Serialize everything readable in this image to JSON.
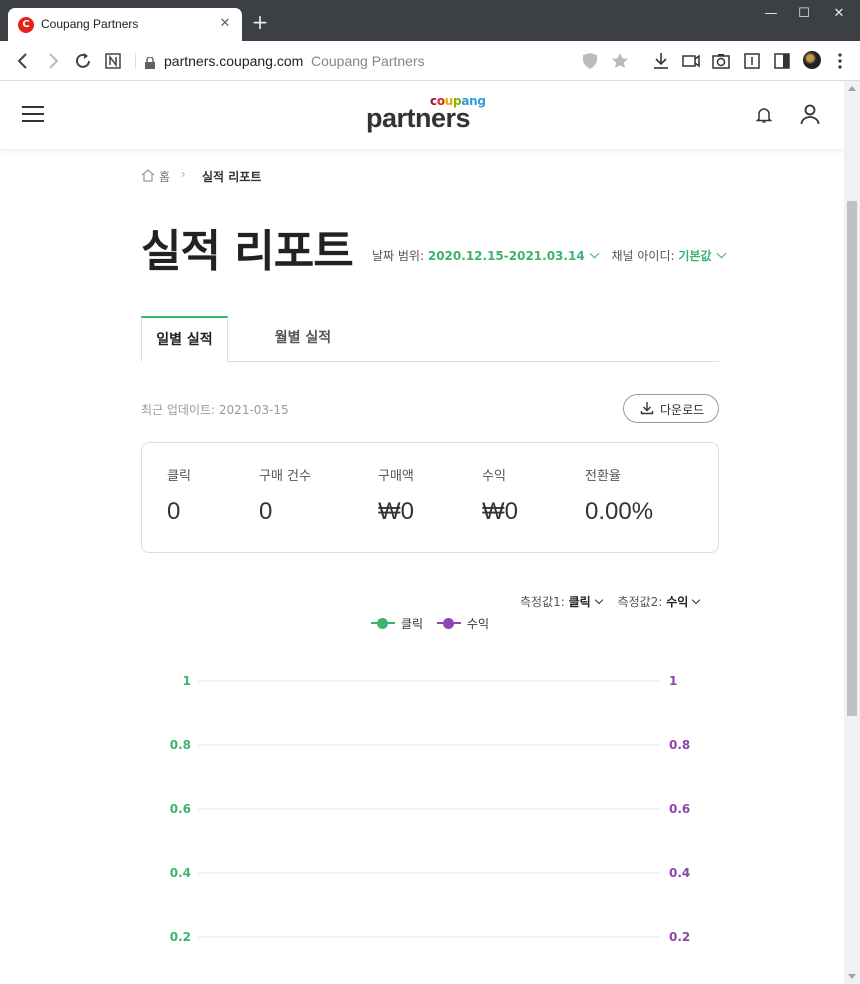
{
  "browser": {
    "tab_title": "Coupang Partners",
    "url": "partners.coupang.com",
    "page_title": "Coupang Partners"
  },
  "header": {
    "logo_small": "coupang",
    "logo_main": "partners"
  },
  "breadcrumb": {
    "home": "홈",
    "current": "실적 리포트"
  },
  "page": {
    "title": "실적 리포트",
    "date_range_label": "날짜 범위:",
    "date_range_value": "2020.12.15-2021.03.14",
    "channel_label": "채널 아이디:",
    "channel_value": "기본값"
  },
  "tabs": [
    {
      "label": "일별 실적",
      "active": true
    },
    {
      "label": "월별 실적",
      "active": false
    }
  ],
  "last_update": "최근 업데이트: 2021-03-15",
  "download_label": "다운로드",
  "stats": [
    {
      "label": "클릭",
      "value": "0"
    },
    {
      "label": "구매 건수",
      "value": "0"
    },
    {
      "label": "구매액",
      "value": "₩0"
    },
    {
      "label": "수익",
      "value": "₩0"
    },
    {
      "label": "전환율",
      "value": "0.00%"
    }
  ],
  "metric_select": {
    "metric1_label": "측정값1:",
    "metric1_value": "클릭",
    "metric2_label": "측정값2:",
    "metric2_value": "수익"
  },
  "colors": {
    "accent_green": "#3cb371",
    "accent_purple": "#8e44ad"
  },
  "chart_data": {
    "type": "line",
    "series": [
      {
        "name": "클릭",
        "color": "#3cb371",
        "axis": "left"
      },
      {
        "name": "수익",
        "color": "#8e44ad",
        "axis": "right"
      }
    ],
    "y_left_ticks": [
      "1",
      "0.8",
      "0.6",
      "0.4",
      "0.2"
    ],
    "y_right_ticks": [
      "1",
      "0.8",
      "0.6",
      "0.4",
      "0.2"
    ],
    "ylim": [
      0,
      1
    ],
    "grid": true,
    "legend": "top-center"
  }
}
